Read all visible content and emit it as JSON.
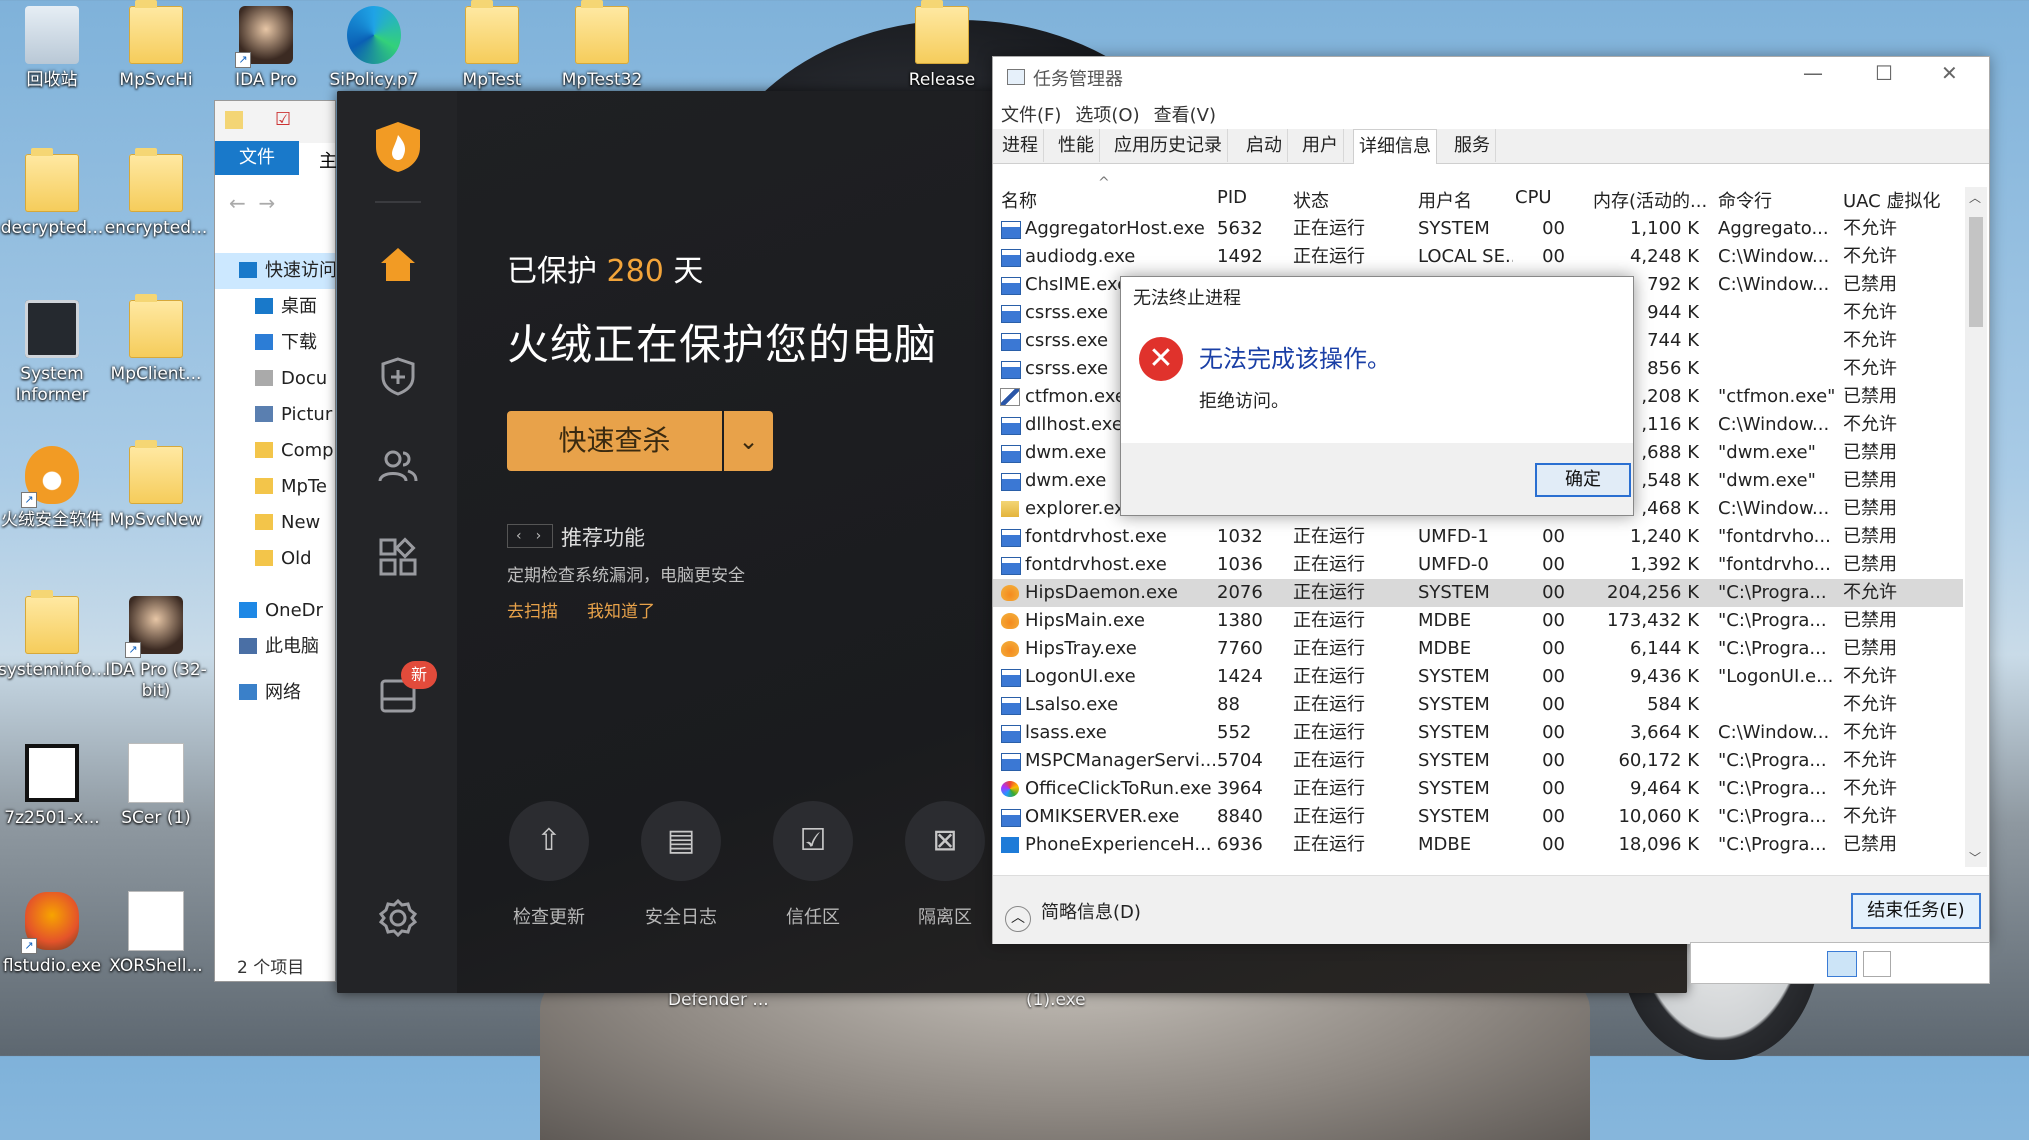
{
  "desktop": {
    "icons": [
      {
        "label": "回收站"
      },
      {
        "label": "MpSvcHi"
      },
      {
        "label": "IDA Pro"
      },
      {
        "label": "SiPolicy.p7"
      },
      {
        "label": "MpTest"
      },
      {
        "label": "MpTest32"
      },
      {
        "label": "Release"
      },
      {
        "label": "decrypted..."
      },
      {
        "label": "encrypted..."
      },
      {
        "label": "System Informer"
      },
      {
        "label": "MpClient..."
      },
      {
        "label": "火绒安全软件"
      },
      {
        "label": "MpSvcNew"
      },
      {
        "label": "systeminfo..."
      },
      {
        "label": "IDA Pro (32-bit)"
      },
      {
        "label": "7z2501-x..."
      },
      {
        "label": "SCer (1)"
      },
      {
        "label": "flstudio.exe"
      },
      {
        "label": "XORShell..."
      }
    ],
    "bottom_labels": [
      "Defender ...",
      "(1).exe"
    ]
  },
  "explorer": {
    "tab_file": "文件",
    "tab_home": "主",
    "tree": [
      {
        "label": "快速访问"
      },
      {
        "label": "桌面"
      },
      {
        "label": "下载"
      },
      {
        "label": "Docu"
      },
      {
        "label": "Pictur"
      },
      {
        "label": "Comp"
      },
      {
        "label": "MpTe"
      },
      {
        "label": "New"
      },
      {
        "label": "Old"
      },
      {
        "label": "OneDr"
      },
      {
        "label": "此电脑"
      },
      {
        "label": "网络"
      }
    ],
    "count": "2 个项目"
  },
  "huorong": {
    "protected_prefix": "已保护",
    "protected_days": "280",
    "protected_suffix": "天",
    "headline": "火绒正在保护您的电脑",
    "scan_button": "快速查杀",
    "recommend_title": "推荐功能",
    "recommend_desc": "定期检查系统漏洞，电脑更安全",
    "link_scan": "去扫描",
    "link_known": "我知道了",
    "new_badge": "新",
    "tools": [
      {
        "label": "检查更新",
        "icon": "upload-icon"
      },
      {
        "label": "安全日志",
        "icon": "log-icon"
      },
      {
        "label": "信任区",
        "icon": "trust-icon"
      },
      {
        "label": "隔离区",
        "icon": "quarantine-icon"
      }
    ],
    "accent": "#e8a24a"
  },
  "taskmgr": {
    "title": "任务管理器",
    "menu": [
      "文件(F)",
      "选项(O)",
      "查看(V)"
    ],
    "tabs": [
      "进程",
      "性能",
      "应用历史记录",
      "启动",
      "用户",
      "详细信息",
      "服务"
    ],
    "active_tab": "详细信息",
    "columns": [
      "名称",
      "PID",
      "状态",
      "用户名",
      "CPU",
      "内存(活动的...",
      "命令行",
      "UAC 虚拟化"
    ],
    "rows": [
      {
        "name": "AggregatorHost.exe",
        "pid": "5632",
        "status": "正在运行",
        "user": "SYSTEM",
        "cpu": "00",
        "mem": "1,100 K",
        "cmd": "Aggregato...",
        "uac": "不允许",
        "icon": "app"
      },
      {
        "name": "audiodg.exe",
        "pid": "1492",
        "status": "正在运行",
        "user": "LOCAL SE...",
        "cpu": "00",
        "mem": "4,248 K",
        "cmd": "C:\\Window...",
        "uac": "不允许",
        "icon": "app"
      },
      {
        "name": "ChsIME.exe",
        "pid": "",
        "status": "",
        "user": "",
        "cpu": "",
        "mem": "792 K",
        "cmd": "C:\\Window...",
        "uac": "已禁用",
        "icon": "app"
      },
      {
        "name": "csrss.exe",
        "pid": "",
        "status": "",
        "user": "",
        "cpu": "",
        "mem": "944 K",
        "cmd": "",
        "uac": "不允许",
        "icon": "app"
      },
      {
        "name": "csrss.exe",
        "pid": "",
        "status": "",
        "user": "",
        "cpu": "",
        "mem": "744 K",
        "cmd": "",
        "uac": "不允许",
        "icon": "app"
      },
      {
        "name": "csrss.exe",
        "pid": "",
        "status": "",
        "user": "",
        "cpu": "",
        "mem": "856 K",
        "cmd": "",
        "uac": "不允许",
        "icon": "app"
      },
      {
        "name": "ctfmon.exe",
        "pid": "",
        "status": "",
        "user": "",
        "cpu": "",
        "mem": ",208 K",
        "cmd": "\"ctfmon.exe\"",
        "uac": "已禁用",
        "icon": "pen"
      },
      {
        "name": "dllhost.exe",
        "pid": "",
        "status": "",
        "user": "",
        "cpu": "",
        "mem": ",116 K",
        "cmd": "C:\\Window...",
        "uac": "不允许",
        "icon": "app"
      },
      {
        "name": "dwm.exe",
        "pid": "",
        "status": "",
        "user": "",
        "cpu": "",
        "mem": ",688 K",
        "cmd": "\"dwm.exe\"",
        "uac": "已禁用",
        "icon": "app"
      },
      {
        "name": "dwm.exe",
        "pid": "",
        "status": "",
        "user": "",
        "cpu": "",
        "mem": ",548 K",
        "cmd": "\"dwm.exe\"",
        "uac": "已禁用",
        "icon": "app"
      },
      {
        "name": "explorer.exe",
        "pid": "",
        "status": "",
        "user": "",
        "cpu": "",
        "mem": ",468 K",
        "cmd": "C:\\Window...",
        "uac": "已禁用",
        "icon": "exp"
      },
      {
        "name": "fontdrvhost.exe",
        "pid": "1032",
        "status": "正在运行",
        "user": "UMFD-1",
        "cpu": "00",
        "mem": "1,240 K",
        "cmd": "\"fontdrvho...",
        "uac": "已禁用",
        "icon": "app"
      },
      {
        "name": "fontdrvhost.exe",
        "pid": "1036",
        "status": "正在运行",
        "user": "UMFD-0",
        "cpu": "00",
        "mem": "1,392 K",
        "cmd": "\"fontdrvho...",
        "uac": "已禁用",
        "icon": "app"
      },
      {
        "name": "HipsDaemon.exe",
        "pid": "2076",
        "status": "正在运行",
        "user": "SYSTEM",
        "cpu": "00",
        "mem": "204,256 K",
        "cmd": "\"C:\\Progra...",
        "uac": "不允许",
        "icon": "hr",
        "selected": true
      },
      {
        "name": "HipsMain.exe",
        "pid": "1380",
        "status": "正在运行",
        "user": "MDBE",
        "cpu": "00",
        "mem": "173,432 K",
        "cmd": "\"C:\\Progra...",
        "uac": "已禁用",
        "icon": "hr"
      },
      {
        "name": "HipsTray.exe",
        "pid": "7760",
        "status": "正在运行",
        "user": "MDBE",
        "cpu": "00",
        "mem": "6,144 K",
        "cmd": "\"C:\\Progra...",
        "uac": "已禁用",
        "icon": "hr"
      },
      {
        "name": "LogonUI.exe",
        "pid": "1424",
        "status": "正在运行",
        "user": "SYSTEM",
        "cpu": "00",
        "mem": "9,436 K",
        "cmd": "\"LogonUI.e...",
        "uac": "不允许",
        "icon": "app"
      },
      {
        "name": "Lsalso.exe",
        "pid": "88",
        "status": "正在运行",
        "user": "SYSTEM",
        "cpu": "00",
        "mem": "584 K",
        "cmd": "",
        "uac": "不允许",
        "icon": "app"
      },
      {
        "name": "lsass.exe",
        "pid": "552",
        "status": "正在运行",
        "user": "SYSTEM",
        "cpu": "00",
        "mem": "3,664 K",
        "cmd": "C:\\Window...",
        "uac": "不允许",
        "icon": "app"
      },
      {
        "name": "MSPCManagerServi...",
        "pid": "5704",
        "status": "正在运行",
        "user": "SYSTEM",
        "cpu": "00",
        "mem": "60,172 K",
        "cmd": "\"C:\\Progra...",
        "uac": "不允许",
        "icon": "app"
      },
      {
        "name": "OfficeClickToRun.exe",
        "pid": "3964",
        "status": "正在运行",
        "user": "SYSTEM",
        "cpu": "00",
        "mem": "9,464 K",
        "cmd": "\"C:\\Progra...",
        "uac": "不允许",
        "icon": "off"
      },
      {
        "name": "OMIKSERVER.exe",
        "pid": "8840",
        "status": "正在运行",
        "user": "SYSTEM",
        "cpu": "00",
        "mem": "10,060 K",
        "cmd": "\"C:\\Progra...",
        "uac": "不允许",
        "icon": "app"
      },
      {
        "name": "PhoneExperienceH...",
        "pid": "6936",
        "status": "正在运行",
        "user": "MDBE",
        "cpu": "00",
        "mem": "18,096 K",
        "cmd": "\"C:\\Progra...",
        "uac": "已禁用",
        "icon": "ph"
      }
    ],
    "fewer_details": "简略信息(D)",
    "end_task": "结束任务(E)"
  },
  "dialog": {
    "title": "无法终止进程",
    "message": "无法完成该操作。",
    "detail": "拒绝访问。",
    "ok": "确定"
  }
}
